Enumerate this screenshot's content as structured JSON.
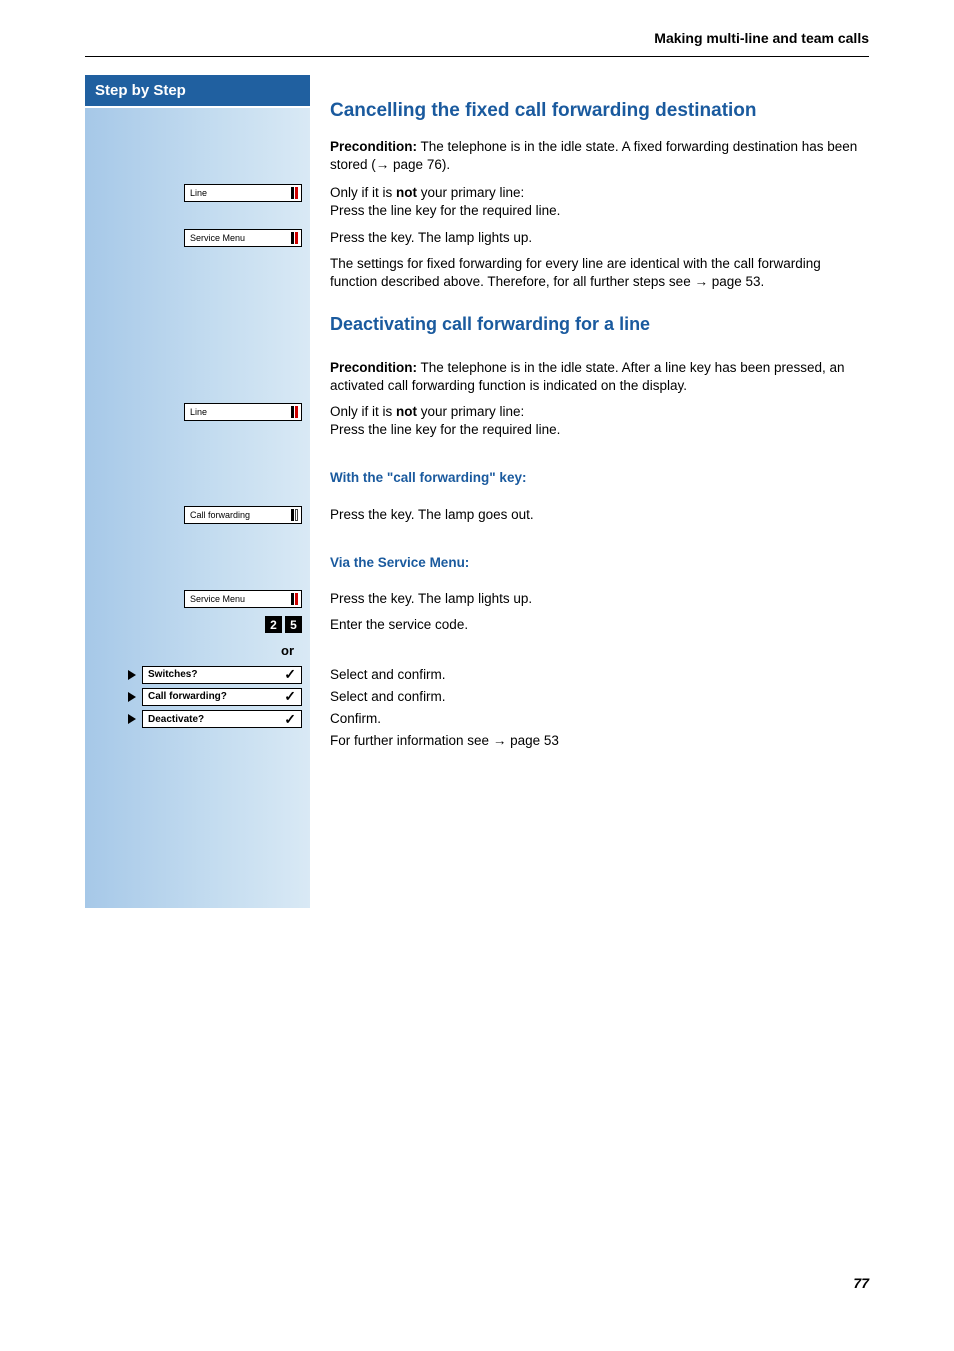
{
  "header": {
    "section": "Making multi-line and team calls"
  },
  "sidebar": {
    "title": "Step by Step"
  },
  "keys": {
    "line": "Line",
    "service_menu": "Service Menu",
    "call_forwarding": "Call forwarding"
  },
  "digits": {
    "d1": "2",
    "d2": "5"
  },
  "or_label": "or",
  "menu": {
    "switches": "Switches?",
    "call_forwarding": "Call forwarding?",
    "deactivate": "Deactivate?",
    "check": "✓"
  },
  "section1": {
    "heading": "Cancelling the fixed call forwarding destination",
    "precond_label": "Precondition:",
    "precond_text": " The telephone is in the idle state. A fixed forwarding destination has been stored (",
    "precond_pageref": "→ page 76).",
    "line_pre": "Only if it is ",
    "line_not": "not",
    "line_post": " your primary line:",
    "line_press": "Press the line key for the required line.",
    "svc_press": "Press the key. The lamp lights up.",
    "para3": "The settings for fixed forwarding for every line are identical with the call forwarding function described above. Therefore, for all further steps see ",
    "para3_ref": "→ page 53."
  },
  "section2": {
    "heading": "Deactivating call forwarding for a line",
    "precond_label": "Precondition:",
    "precond_text": " The telephone is in the idle state. After a line key has been pressed, an activated call forwarding function is indicated on the display.",
    "line_pre": "Only if it is ",
    "line_not": "not",
    "line_post": " your primary line:",
    "line_press": "Press the line key for the required line.",
    "sub1": "With the \"call forwarding\" key:",
    "cf_press": "Press the key. The lamp goes out.",
    "sub2": "Via the Service Menu:",
    "svc_press": "Press the key. The lamp lights up.",
    "code_enter": "Enter the service code.",
    "sel_confirm": "Select and confirm.",
    "confirm": "Confirm.",
    "further": "For further information see ",
    "further_ref": "→ page 53"
  },
  "page_number": "77"
}
